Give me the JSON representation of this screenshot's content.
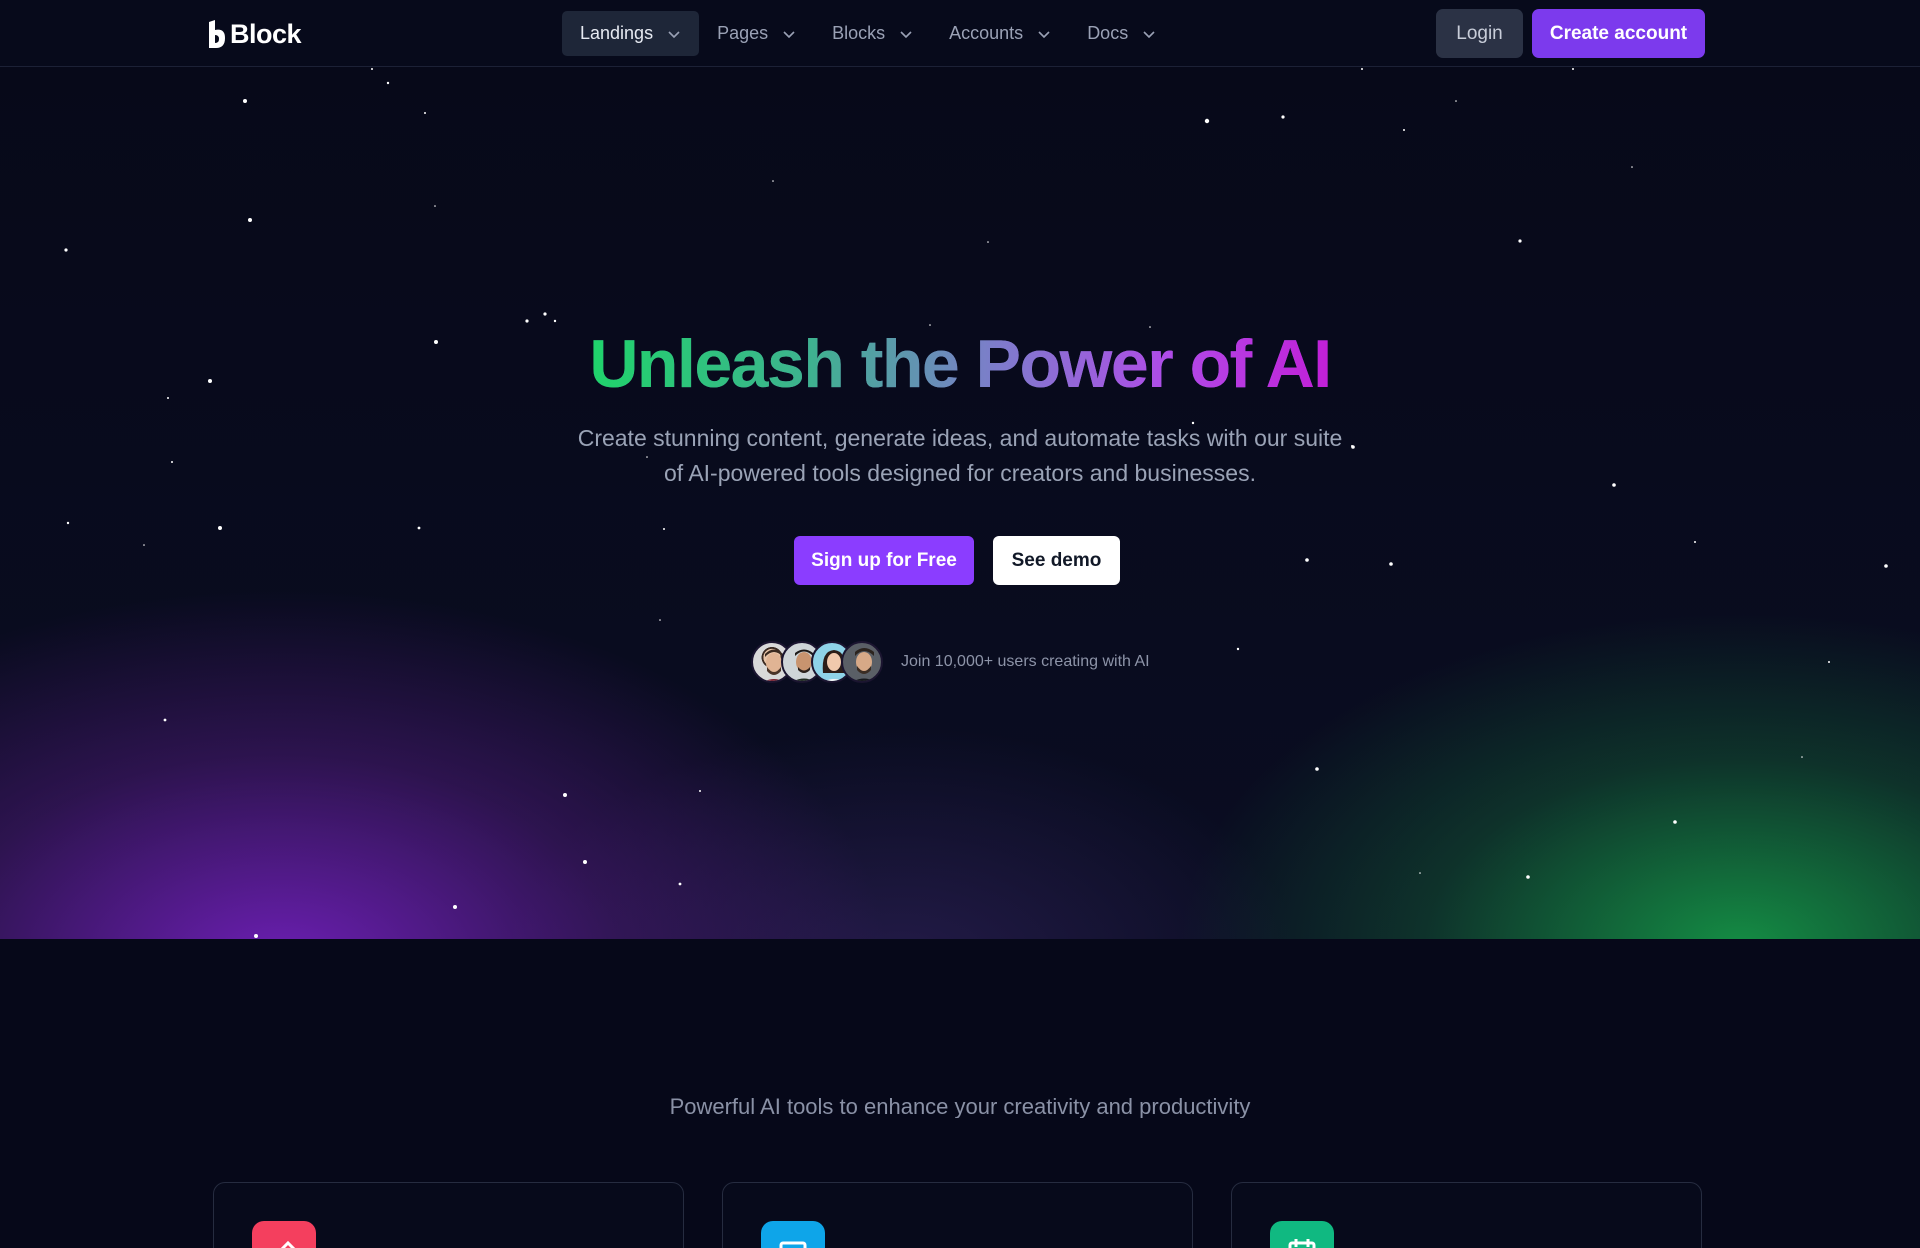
{
  "brand": {
    "name": "Block"
  },
  "nav": {
    "items": [
      {
        "label": "Landings",
        "active": true
      },
      {
        "label": "Pages",
        "active": false
      },
      {
        "label": "Blocks",
        "active": false
      },
      {
        "label": "Accounts",
        "active": false
      },
      {
        "label": "Docs",
        "active": false
      }
    ],
    "login_label": "Login",
    "create_account_label": "Create account"
  },
  "hero": {
    "title": "Unleash the Power of AI",
    "subtitle_line1": "Create stunning content, generate ideas, and automate tasks with our suite",
    "subtitle_line2": "of AI-powered tools designed for creators and businesses.",
    "primary_cta": "Sign up for Free",
    "secondary_cta": "See demo",
    "social_proof": "Join 10,000+ users creating with AI"
  },
  "features": {
    "subtitle": "Powerful AI tools to enhance your creativity and productivity",
    "cards": [
      {
        "icon": "edit-icon",
        "color": "#f43f5e"
      },
      {
        "icon": "monitor-icon",
        "color": "#0ea5e9"
      },
      {
        "icon": "calendar-icon",
        "color": "#10b981"
      }
    ]
  },
  "colors": {
    "accent": "#7c3aed",
    "background": "#060819",
    "gradient_green": "#22c55e",
    "gradient_purple": "#c026d3"
  }
}
